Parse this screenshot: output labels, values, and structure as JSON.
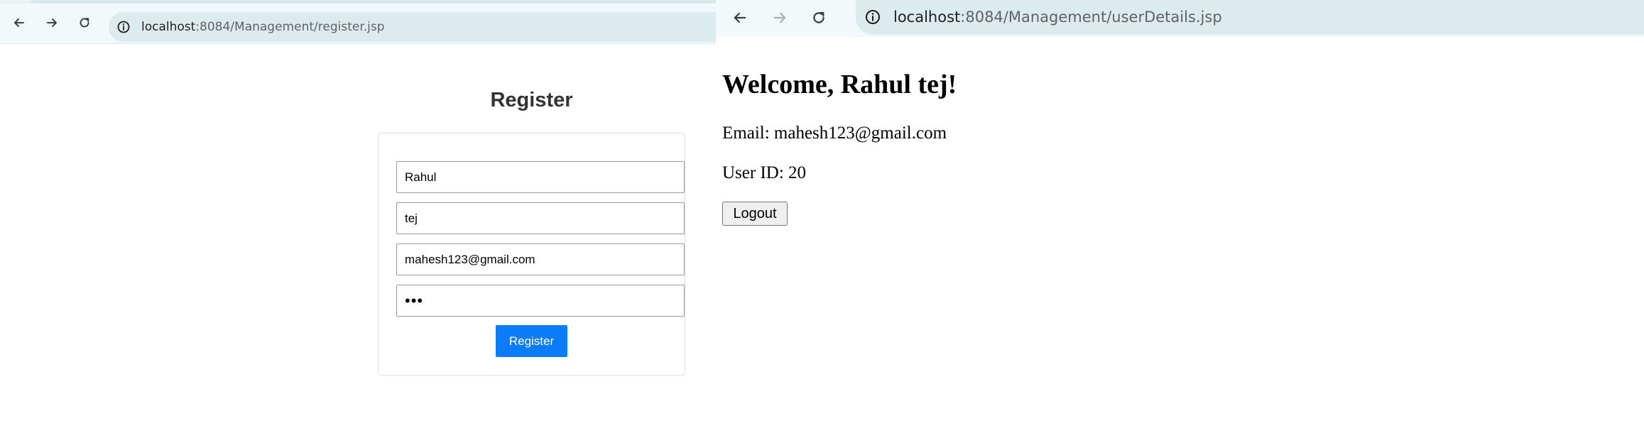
{
  "left_window": {
    "url_host": "localhost",
    "url_path": ":8084/Management/register.jsp",
    "page": {
      "title": "Register",
      "fields": [
        {
          "name": "first-name",
          "value": "Rahul"
        },
        {
          "name": "last-name",
          "value": "tej"
        },
        {
          "name": "email",
          "value": "mahesh123@gmail.com"
        },
        {
          "name": "password",
          "value": "•••"
        }
      ],
      "submit_label": "Register"
    }
  },
  "right_window": {
    "url_host": "localhost",
    "url_path": ":8084/Management/userDetails.jsp",
    "page": {
      "welcome": "Welcome, Rahul tej!",
      "email_line": "Email: mahesh123@gmail.com",
      "user_id_line": "User ID: 20",
      "logout_label": "Logout"
    }
  },
  "colors": {
    "register_button": "#0a7cf7",
    "toolbar": "#f2f9fa",
    "omnibox": "#dcebed"
  },
  "icons": [
    "back-arrow-icon",
    "forward-arrow-icon",
    "reload-icon",
    "site-info-icon"
  ]
}
